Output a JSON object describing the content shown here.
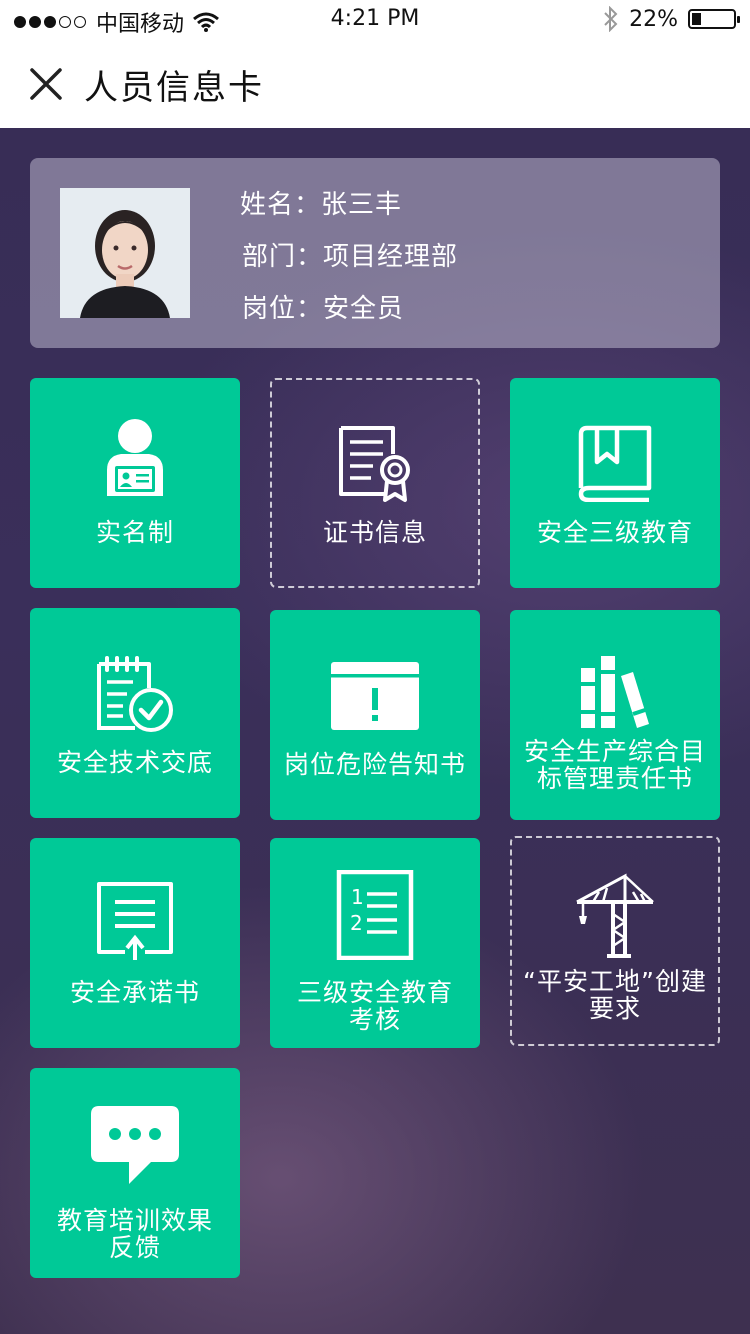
{
  "status": {
    "carrier": "中国移动",
    "time": "4:21 PM",
    "battery": "22%",
    "battery_level": 0.22
  },
  "nav": {
    "title": "人员信息卡"
  },
  "profile": {
    "name_label": "姓名：",
    "name": "张三丰",
    "dept_label": "部门：",
    "dept": "项目经理部",
    "post_label": "岗位：",
    "post": "安全员"
  },
  "tiles": [
    {
      "line1": "实名制",
      "line2": "",
      "icon": "id-badge-icon"
    },
    {
      "line1": "证书信息",
      "line2": "",
      "icon": "certificate-icon"
    },
    {
      "line1": "安全三级教育",
      "line2": "",
      "icon": "book-icon"
    },
    {
      "line1": "安全技术交底",
      "line2": "",
      "icon": "checklist-icon"
    },
    {
      "line1": "岗位危险告知书",
      "line2": "",
      "icon": "warning-board-icon"
    },
    {
      "line1": "安全生产综合目",
      "line2": "标管理责任书",
      "icon": "books-icon"
    },
    {
      "line1": "安全承诺书",
      "line2": "",
      "icon": "commitment-doc-icon"
    },
    {
      "line1": "三级安全教育",
      "line2": "考核",
      "icon": "numbered-list-icon"
    },
    {
      "line1": "“平安工地”创建",
      "line2": "要求",
      "icon": "tower-crane-icon"
    },
    {
      "line1": "教育培训效果",
      "line2": "反馈",
      "icon": "chat-bubble-icon"
    }
  ]
}
